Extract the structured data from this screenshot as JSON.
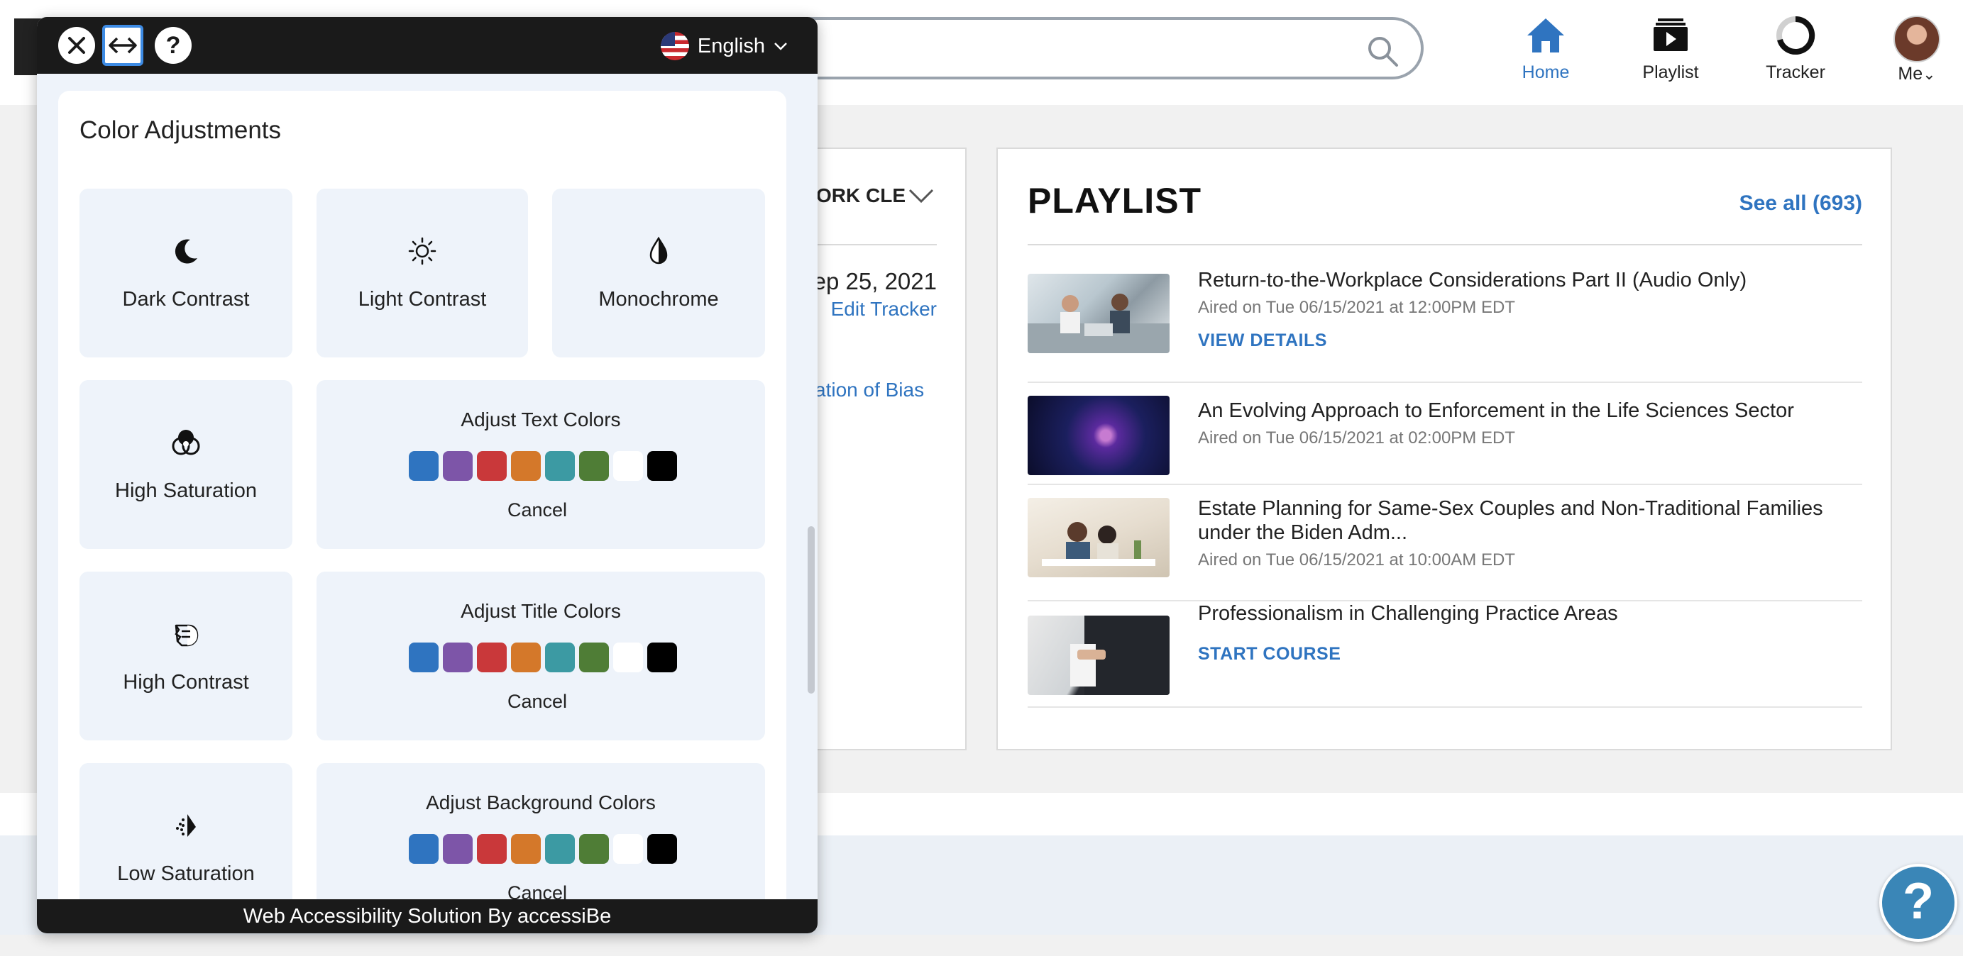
{
  "nav": {
    "search_placeholder": "",
    "items": [
      {
        "label": "Home",
        "icon": "home-icon",
        "active": true
      },
      {
        "label": "Playlist",
        "icon": "playlist-icon",
        "active": false
      },
      {
        "label": "Tracker",
        "icon": "tracker-icon",
        "active": false
      },
      {
        "label": "Me",
        "icon": "avatar",
        "active": false
      }
    ],
    "me_chevron": "⌄"
  },
  "tracker_card": {
    "region_label": "ORK CLE",
    "date": "ep 25, 2021",
    "edit_tracker": "Edit Tracker",
    "link": "ation of Bias"
  },
  "playlist": {
    "title": "PLAYLIST",
    "see_all": "See all (693)",
    "items": [
      {
        "title": "Return-to-the-Workplace Considerations Part II (Audio Only)",
        "aired": "Aired on Tue 06/15/2021 at 12:00PM EDT",
        "action": "VIEW DETAILS"
      },
      {
        "title": "An Evolving Approach to Enforcement in the Life Sciences Sector",
        "aired": "Aired on Tue 06/15/2021 at 02:00PM EDT",
        "action": ""
      },
      {
        "title": "Estate Planning for Same-Sex Couples and Non-Traditional Families under the Biden Adm...",
        "aired": "Aired on Tue 06/15/2021 at 10:00AM EDT",
        "action": ""
      },
      {
        "title": "Professionalism in Challenging Practice Areas",
        "aired": "",
        "action": "START COURSE"
      }
    ]
  },
  "help_fab": "?",
  "accessibility": {
    "language": "English",
    "help_label": "?",
    "section_title": "Color Adjustments",
    "tiles": {
      "dark_contrast": "Dark Contrast",
      "light_contrast": "Light Contrast",
      "monochrome": "Monochrome",
      "high_saturation": "High Saturation",
      "high_contrast": "High Contrast",
      "low_saturation": "Low Saturation"
    },
    "color_groups": [
      {
        "title": "Adjust Text Colors",
        "cancel": "Cancel"
      },
      {
        "title": "Adjust Title Colors",
        "cancel": "Cancel"
      },
      {
        "title": "Adjust Background Colors",
        "cancel": "Cancel"
      }
    ],
    "swatch_colors": [
      "#2f74c0",
      "#7d55a8",
      "#c9383a",
      "#d4782a",
      "#3c9aa3",
      "#4f7d36",
      "#ffffff",
      "#000000"
    ],
    "footer": "Web Accessibility Solution By accessiBe"
  },
  "colors": {
    "accent_blue": "#2f74c0",
    "panel_dark": "#1a1a1a",
    "tile_bg": "#eef3fa"
  }
}
